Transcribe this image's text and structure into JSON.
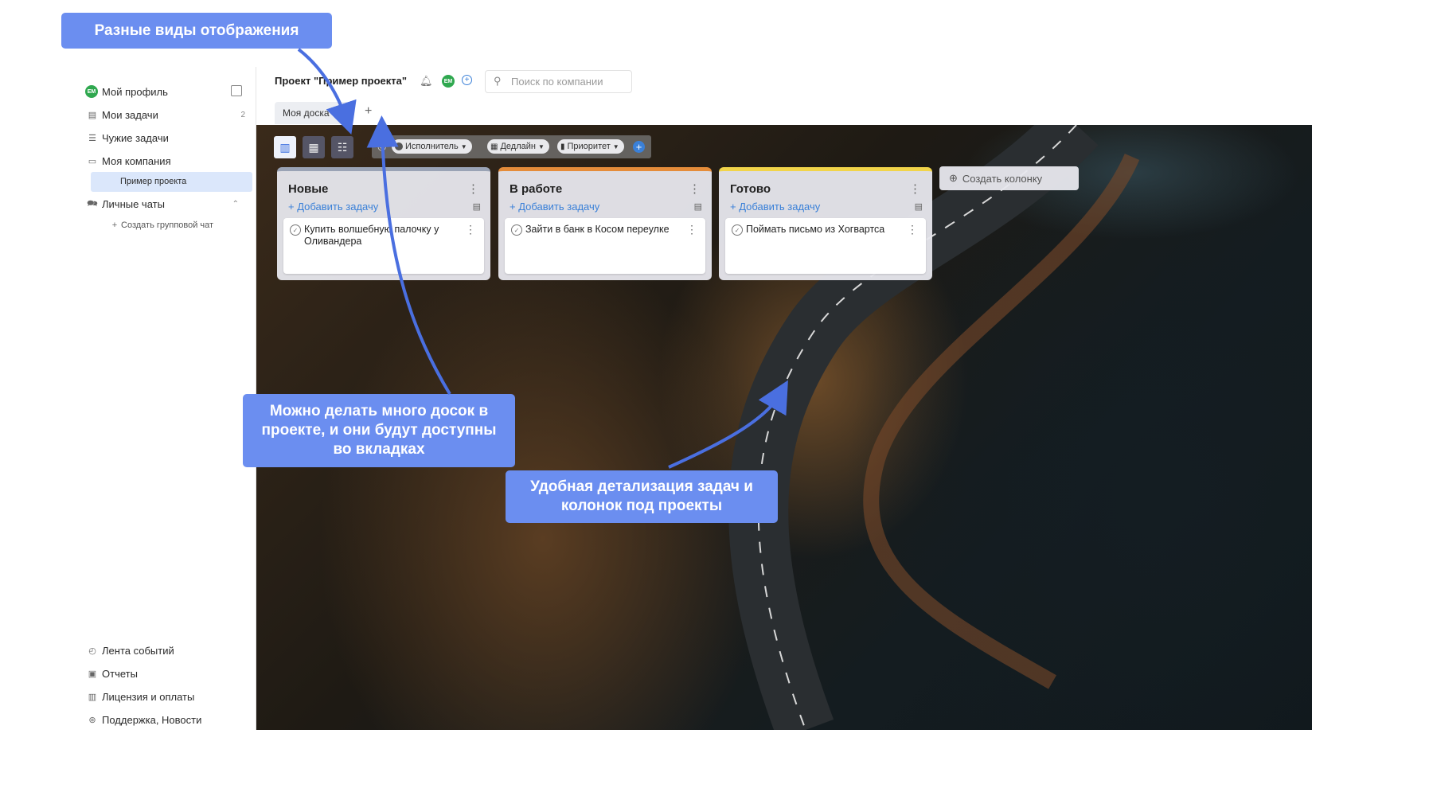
{
  "sidebar": {
    "profile": {
      "avatar": "ЕМ",
      "label": "Мой профиль"
    },
    "items": [
      {
        "label": "Мои задачи",
        "count": "2",
        "icon": "task-icon"
      },
      {
        "label": "Чужие задачи",
        "icon": "list-icon"
      },
      {
        "label": "Моя компания",
        "icon": "briefcase-icon"
      },
      {
        "label": "Пример проекта",
        "icon": ""
      },
      {
        "label": "Личные чаты",
        "icon": "chat-icon"
      },
      {
        "label": "Создать групповой чат",
        "icon": "plus-icon"
      }
    ],
    "bottom_items": [
      {
        "label": "Лента событий",
        "icon": "feed-icon"
      },
      {
        "label": "Отчеты",
        "icon": "reports-icon"
      },
      {
        "label": "Лицензия и оплаты",
        "icon": "license-icon"
      },
      {
        "label": "Поддержка, Новости",
        "icon": "support-icon"
      }
    ]
  },
  "header": {
    "project_title": "Проект \"Пример проекта\"",
    "avatar": "ЕМ",
    "search_placeholder": "Поиск по компании"
  },
  "tabs": {
    "active": "Моя доска",
    "add": "+"
  },
  "filters": [
    {
      "label": "Исполнитель"
    },
    {
      "label": "Дедлайн"
    },
    {
      "label": "Приоритет"
    }
  ],
  "columns": [
    {
      "title": "Новые",
      "color": "#9aa3b5",
      "add_label": "+ Добавить задачу",
      "card": "Купить волшебную палочку у Оливандера"
    },
    {
      "title": "В работе",
      "color": "#e58c3a",
      "add_label": "+ Добавить задачу",
      "card": "Зайти в банк в Косом переулке"
    },
    {
      "title": "Готово",
      "color": "#f1d44a",
      "add_label": "+ Добавить задачу",
      "card": "Поймать письмо из Хогвартса"
    }
  ],
  "add_column_label": "Создать колонку",
  "callouts": {
    "views": "Разные виды отображения",
    "boards": "Можно делать много досок в проекте, и они будут доступны во вкладках",
    "detail": "Удобная детализация задач и колонок под проекты"
  },
  "colors": {
    "accent": "#6b8ef0",
    "link": "#3a80d8",
    "active_item": "#dbe7fb"
  }
}
